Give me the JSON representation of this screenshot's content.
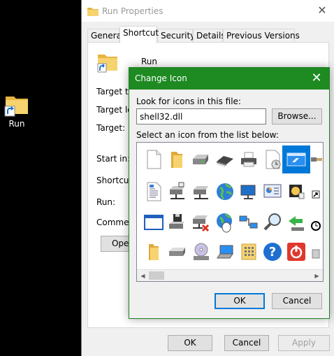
{
  "desktop": {
    "icon_label": "Run",
    "icon_name": "folder-shortcut-icon"
  },
  "props": {
    "title": "Run Properties",
    "close_glyph": "✕",
    "tabs": [
      {
        "label": "General",
        "active": false
      },
      {
        "label": "Shortcut",
        "active": true
      },
      {
        "label": "Security",
        "active": false
      },
      {
        "label": "Details",
        "active": false
      },
      {
        "label": "Previous Versions",
        "active": false
      }
    ],
    "shortcut_name": "Run",
    "fields": {
      "target_type": "Target typ",
      "target_location": "Target loc",
      "target": "Target:",
      "start_in": "Start in:",
      "shortcut_key": "Shortcut k",
      "run": "Run:",
      "comment": "Comment:"
    },
    "open_button": "Open",
    "ok_button": "OK",
    "cancel_button": "Cancel",
    "apply_button": "Apply"
  },
  "dialog": {
    "title": "Change Icon",
    "close_glyph": "✕",
    "file_label": "Look for icons in this file:",
    "file_value": "shell32.dll",
    "browse_button": "Browse...",
    "list_label": "Select an icon from the list below:",
    "ok_button": "OK",
    "cancel_button": "Cancel",
    "selected_icon": "run-dialog-icon",
    "icons": [
      [
        "blank-document-icon",
        "folder-icon",
        "drive-icon",
        "chip-icon",
        "printer-icon",
        "document-clock-icon",
        "run-dialog-icon",
        "partial-icon"
      ],
      [
        "text-document-icon",
        "network-drive-icon",
        "network-drive-icon",
        "globe-icon",
        "monitor-network-icon",
        "control-panel-icon",
        "cd-player-icon",
        "shortcut-arrow-icon"
      ],
      [
        "window-icon",
        "floppy-drive-icon",
        "network-drive-disconnected-icon",
        "globe-mouse-icon",
        "network-computers-icon",
        "magnifier-icon",
        "green-arrow-drive-icon",
        "clock-icon"
      ],
      [
        "folder-partial-icon",
        "removable-drive-icon",
        "cd-drive-icon",
        "laptop-icon",
        "keypad-folder-icon",
        "help-icon",
        "power-icon",
        "partial-icon"
      ]
    ]
  }
}
